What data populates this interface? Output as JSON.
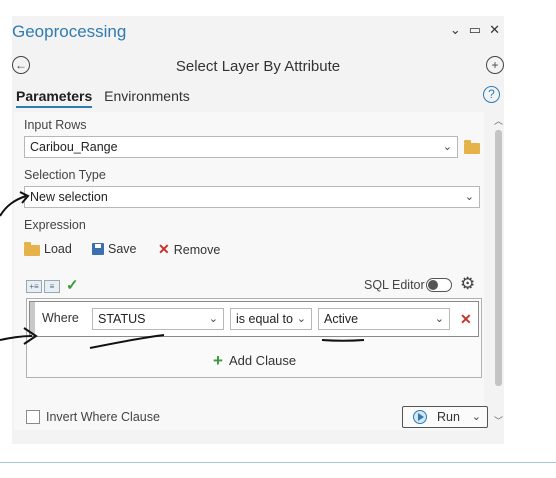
{
  "window": {
    "title": "Geoprocessing",
    "controls": [
      "⌄",
      "▭",
      "✕"
    ]
  },
  "header": {
    "back_icon": "back-arrow-icon",
    "tool_title": "Select Layer By Attribute",
    "add_icon": "plus-circle-icon"
  },
  "tabs": [
    {
      "label": "Parameters",
      "active": true
    },
    {
      "label": "Environments",
      "active": false
    }
  ],
  "help": "?",
  "input_rows": {
    "label": "Input Rows",
    "value": "Caribou_Range"
  },
  "selection_type": {
    "label": "Selection Type",
    "value": "New selection"
  },
  "expression": {
    "label": "Expression",
    "load": "Load",
    "save": "Save",
    "remove": "Remove",
    "sql_editor": "SQL Editor",
    "sql_editor_on": false,
    "clause": {
      "where": "Where",
      "field": "STATUS",
      "operator": "is equal to",
      "value": "Active"
    },
    "add_clause": "Add Clause"
  },
  "invert_where": {
    "label": "Invert Where Clause",
    "checked": false
  },
  "run": {
    "label": "Run"
  },
  "colors": {
    "accent": "#2f7bb4",
    "remove": "#c8322a",
    "ok": "#3a9a3a"
  }
}
